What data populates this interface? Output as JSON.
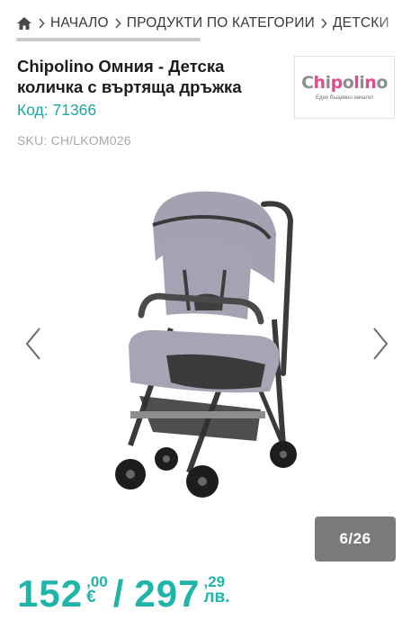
{
  "breadcrumb": {
    "items": [
      "НАЧАЛО",
      "ПРОДУКТИ ПО КАТЕГОРИИ",
      "ДЕТСКИ"
    ]
  },
  "product": {
    "title_line1": "Chipolino Омния - Детска",
    "title_line2": "количка с въртяща дръжка",
    "code": "Код: 71366",
    "sku": "SKU: CH/LKOM026"
  },
  "brand": {
    "name": "Chipolino",
    "letters": [
      "C",
      "h",
      "i",
      "p",
      "o",
      "l",
      "i",
      "n",
      "o"
    ],
    "tagline": "Едно бъщевно начало!",
    "colors": [
      "#8e8e8e",
      "#e14a8f",
      "#8e8e8e",
      "#e14a8f",
      "#8e8e8e",
      "#e14a8f",
      "#8e8e8e",
      "#e14a8f",
      "#8e8e8e"
    ]
  },
  "gallery": {
    "counter": "6/26",
    "prev_icon": "chevron-left-icon",
    "next_icon": "chevron-right-icon"
  },
  "price": {
    "eur_whole": "152",
    "eur_sep": ",",
    "eur_cents": "00",
    "eur_currency": "€",
    "slash": "/",
    "bgn_whole": "297",
    "bgn_sep": ",",
    "bgn_cents": "29",
    "bgn_currency": "лв.",
    "accent": "#1fb5a9"
  }
}
